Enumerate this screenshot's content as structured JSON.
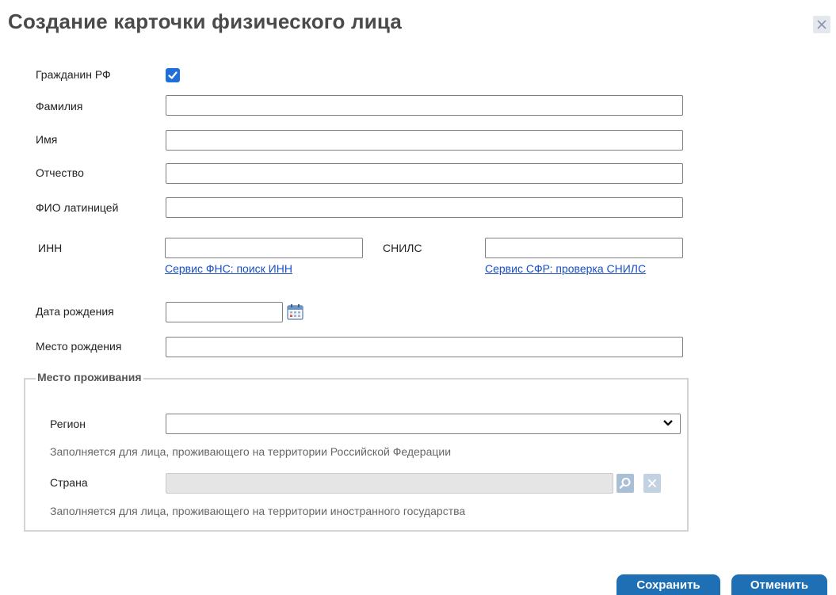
{
  "dialog": {
    "title": "Создание карточки физического лица"
  },
  "form": {
    "citizen_label": "Гражданин РФ",
    "citizen_checked": true,
    "last_name_label": "Фамилия",
    "last_name_value": "",
    "first_name_label": "Имя",
    "first_name_value": "",
    "patronymic_label": "Отчество",
    "patronymic_value": "",
    "latin_name_label": "ФИО латиницей",
    "latin_name_value": "",
    "inn_label": "ИНН",
    "inn_value": "",
    "inn_link": "Сервис ФНС: поиск ИНН",
    "snils_label": "СНИЛС",
    "snils_value": "",
    "snils_link": "Сервис СФР: проверка СНИЛС",
    "birth_date_label": "Дата рождения",
    "birth_date_value": "",
    "birth_place_label": "Место рождения",
    "birth_place_value": ""
  },
  "residence": {
    "legend": "Место проживания",
    "region_label": "Регион",
    "region_value": "",
    "region_hint": "Заполняется для лица, проживающего на территории Российской Федерации",
    "country_label": "Страна",
    "country_value": "",
    "country_hint": "Заполняется для лица, проживающего на территории иностранного государства"
  },
  "actions": {
    "save_label": "Сохранить",
    "cancel_label": "Отменить"
  },
  "icons": {
    "close": "close-icon",
    "checkbox": "checkmark-icon",
    "calendar": "calendar-icon",
    "dropdown": "chevron-down-icon",
    "search": "search-icon",
    "clear": "close-icon"
  },
  "colors": {
    "title": "#4a4a4a",
    "link": "#1a4fc4",
    "checkbox": "#1e6fd9",
    "button": "#1f6fb5"
  }
}
